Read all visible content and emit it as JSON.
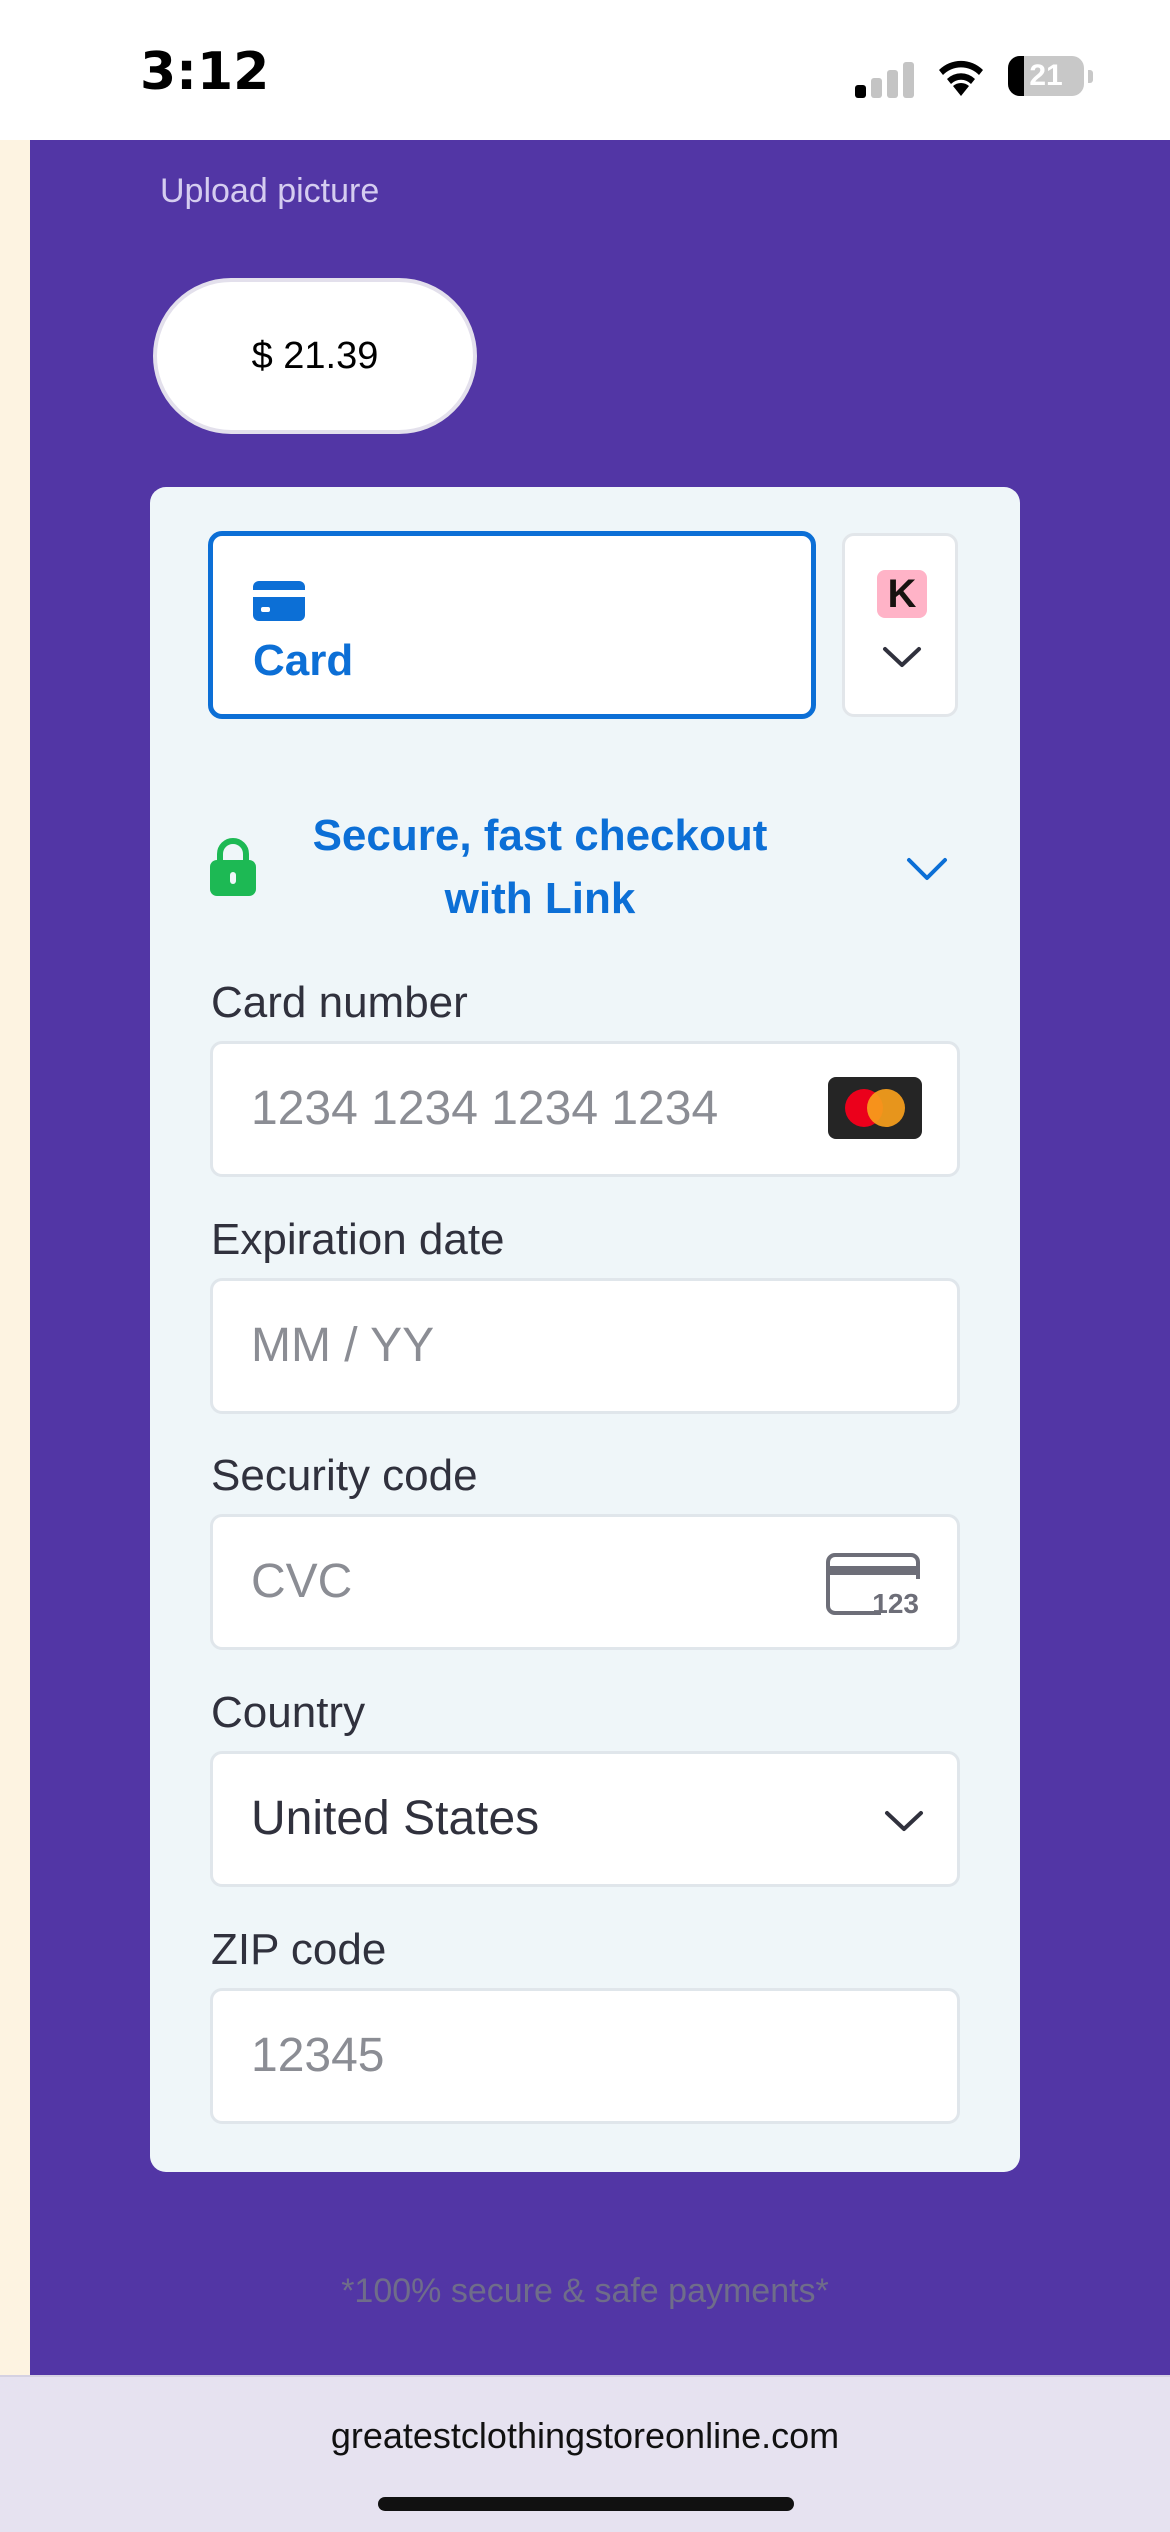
{
  "status_bar": {
    "time": "3:12",
    "battery": "21",
    "battery_level": 0.21
  },
  "upload": {
    "label": "Upload picture"
  },
  "price": {
    "amount": "$ 21.39"
  },
  "payment_methods": {
    "selected_label": "Card",
    "other_badge": "K"
  },
  "link": {
    "text": "Secure, fast checkout with Link"
  },
  "form": {
    "card_number": {
      "label": "Card number",
      "placeholder": "1234 1234 1234 1234"
    },
    "expiration": {
      "label": "Expiration date",
      "placeholder": "MM / YY"
    },
    "security_code": {
      "label": "Security code",
      "placeholder": "CVC",
      "icon_text": "123"
    },
    "country": {
      "label": "Country",
      "value": "United States"
    },
    "zip": {
      "label": "ZIP code",
      "placeholder": "12345"
    }
  },
  "footer": {
    "secure_note": "*100% secure & safe payments*"
  },
  "browser": {
    "url": "greatestclothingstoreonline.com"
  },
  "colors": {
    "brand_purple": "#5236a5",
    "accent_blue": "#0c6fd6",
    "lock_green": "#1db954",
    "klarna_pink": "#ffb3c7"
  }
}
